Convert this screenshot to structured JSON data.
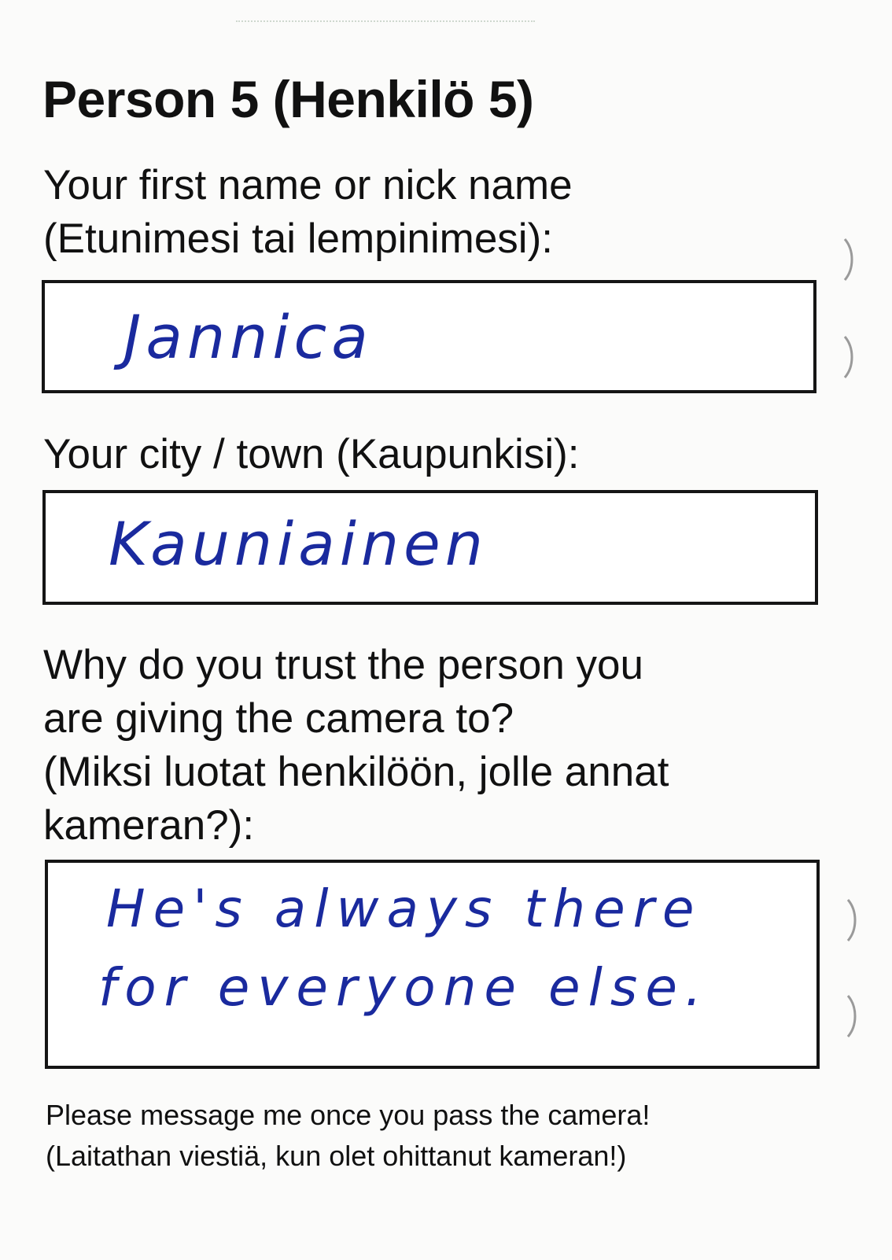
{
  "form": {
    "title": "Person 5 (Henkilö 5)",
    "fields": {
      "name": {
        "label_en": "Your first name or nick name",
        "label_fi": "(Etunimesi tai lempinimesi):",
        "value": "Jannica"
      },
      "city": {
        "label": "Your city / town (Kaupunkisi):",
        "value": "Kauniainen"
      },
      "trust": {
        "label_line1": "Why do you trust the person you",
        "label_line2": "are giving the camera to?",
        "label_line3": "(Miksi luotat henkilöön, jolle annat",
        "label_line4": "kameran?):",
        "value_line1": "He's always there",
        "value_line2": "for everyone else."
      }
    },
    "note": {
      "line1": "Please message me once you pass the camera!",
      "line2": "(Laitathan viestiä, kun olet ohittanut kameran!)"
    }
  },
  "colors": {
    "ink": "#1a2a9e",
    "text": "#111111",
    "border": "#151515"
  }
}
